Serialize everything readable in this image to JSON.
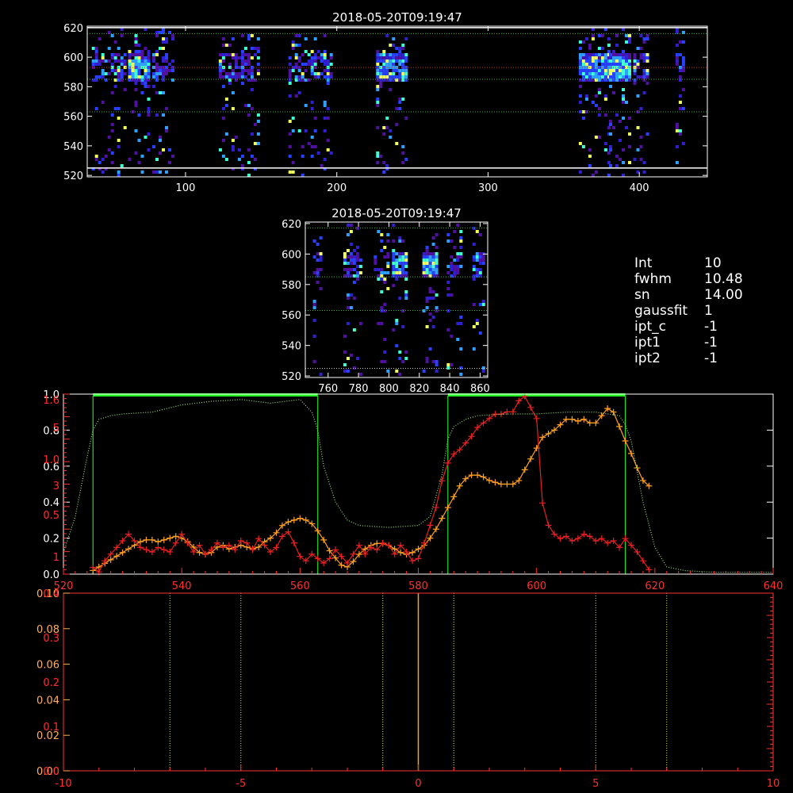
{
  "colors": {
    "background": "#000000",
    "axis_white": "#ffffff",
    "axis_red": "#ff3030",
    "orange": "#ffa020",
    "red": "#e82020",
    "green": "#22dd22",
    "dotted_green": "#9be07a",
    "yellow_dotted": "#e8e870"
  },
  "info": [
    {
      "key": "Int",
      "value": "10"
    },
    {
      "key": "fwhm",
      "value": "10.48"
    },
    {
      "key": "sn",
      "value": "14.00"
    },
    {
      "key": "gaussfit",
      "value": "1"
    },
    {
      "key": "ipt_c",
      "value": "-1"
    },
    {
      "key": "ipt1",
      "value": "-1"
    },
    {
      "key": "ipt2",
      "value": "-1"
    }
  ],
  "chart_data": [
    {
      "id": "top_image",
      "type": "heatmap",
      "title": "2018-05-20T09:19:47",
      "xlim": [
        35,
        445
      ],
      "ylim": [
        519,
        621
      ],
      "xticks": [
        100,
        200,
        300,
        400
      ],
      "yticks": [
        520,
        540,
        560,
        580,
        600,
        620
      ],
      "hlines": [
        {
          "y": 525,
          "style": "solid",
          "color": "#ffffff"
        },
        {
          "y": 563,
          "style": "dotted",
          "color": "#33bb33"
        },
        {
          "y": 585,
          "style": "dotted",
          "color": "#33bb33"
        },
        {
          "y": 593,
          "style": "dotted",
          "color": "#cc3322"
        },
        {
          "y": 616,
          "style": "dotted",
          "color": "#33bb33"
        },
        {
          "y": 620,
          "style": "solid",
          "color": "#ffffff"
        }
      ],
      "emission_bands": [
        [
          38,
          60
        ],
        [
          62,
          76
        ],
        [
          78,
          92
        ],
        [
          122,
          148
        ],
        [
          168,
          196
        ],
        [
          226,
          246
        ],
        [
          360,
          380
        ],
        [
          380,
          394
        ],
        [
          396,
          406
        ],
        [
          424,
          430
        ]
      ],
      "bright_bands": [
        [
          62,
          72
        ],
        [
          228,
          244
        ],
        [
          362,
          376
        ],
        [
          378,
          390
        ]
      ]
    },
    {
      "id": "mid_image",
      "type": "heatmap",
      "title": "2018-05-20T09:19:47",
      "xlim": [
        745,
        865
      ],
      "ylim": [
        519,
        621
      ],
      "xticks": [
        760,
        780,
        800,
        820,
        840,
        860
      ],
      "yticks": [
        520,
        540,
        560,
        580,
        600,
        620
      ],
      "hlines": [
        {
          "y": 525,
          "style": "dotted",
          "color": "#cccccc"
        },
        {
          "y": 563,
          "style": "dotted",
          "color": "#33bb33"
        },
        {
          "y": 585,
          "style": "dotted",
          "color": "#33bb33"
        },
        {
          "y": 617,
          "style": "dotted",
          "color": "#33bb33"
        }
      ],
      "emission_bands": [
        [
          750,
          756
        ],
        [
          770,
          782
        ],
        [
          790,
          800
        ],
        [
          802,
          812
        ],
        [
          822,
          832
        ],
        [
          838,
          848
        ],
        [
          855,
          862
        ]
      ],
      "bright_bands": [
        [
          804,
          810
        ],
        [
          824,
          830
        ]
      ]
    },
    {
      "id": "profile",
      "type": "line",
      "xlim": [
        520,
        640
      ],
      "xticks": [
        520,
        540,
        560,
        580,
        600,
        620,
        640
      ],
      "ylim_left_white": [
        0,
        1.0
      ],
      "yticks_left_white": [
        "0.0",
        "0.2",
        "0.4",
        "0.6",
        "0.8",
        "1.0"
      ],
      "ylim_left_red": [
        0,
        1.6
      ],
      "yticks_left_red": [
        "1",
        "1.0",
        "0.5",
        "3",
        "5",
        "1.6"
      ],
      "green_boxes": [
        [
          525,
          563
        ],
        [
          585,
          615
        ]
      ],
      "series": [
        {
          "color": "#ffa020",
          "marker": "+",
          "x": [
            525,
            526,
            527,
            528,
            529,
            530,
            531,
            532,
            533,
            534,
            535,
            536,
            537,
            538,
            539,
            540,
            541,
            542,
            543,
            544,
            545,
            546,
            547,
            548,
            549,
            550,
            551,
            552,
            553,
            554,
            555,
            556,
            557,
            558,
            559,
            560,
            561,
            562,
            563,
            564,
            565,
            566,
            567,
            568,
            569,
            570,
            571,
            572,
            573,
            574,
            575,
            576,
            577,
            578,
            579,
            580,
            581,
            582,
            583,
            584,
            585,
            586,
            587,
            588,
            589,
            590,
            591,
            592,
            593,
            594,
            595,
            596,
            597,
            598,
            599,
            600,
            601,
            602,
            603,
            604,
            605,
            606,
            607,
            608,
            609,
            610,
            611,
            612,
            613,
            614,
            615,
            616,
            617,
            618,
            619
          ],
          "y": [
            0.02,
            0.04,
            0.06,
            0.08,
            0.1,
            0.12,
            0.14,
            0.16,
            0.18,
            0.19,
            0.19,
            0.18,
            0.19,
            0.2,
            0.21,
            0.2,
            0.18,
            0.15,
            0.12,
            0.11,
            0.12,
            0.15,
            0.16,
            0.14,
            0.15,
            0.16,
            0.15,
            0.14,
            0.15,
            0.18,
            0.2,
            0.23,
            0.27,
            0.29,
            0.3,
            0.31,
            0.3,
            0.28,
            0.24,
            0.19,
            0.13,
            0.09,
            0.05,
            0.04,
            0.07,
            0.11,
            0.14,
            0.16,
            0.17,
            0.17,
            0.16,
            0.14,
            0.12,
            0.11,
            0.12,
            0.14,
            0.16,
            0.2,
            0.25,
            0.31,
            0.37,
            0.43,
            0.49,
            0.53,
            0.55,
            0.55,
            0.54,
            0.52,
            0.51,
            0.5,
            0.5,
            0.5,
            0.52,
            0.58,
            0.64,
            0.7,
            0.76,
            0.78,
            0.8,
            0.83,
            0.86,
            0.86,
            0.85,
            0.86,
            0.84,
            0.84,
            0.88,
            0.92,
            0.9,
            0.82,
            0.74,
            0.67,
            0.59,
            0.52,
            0.49
          ]
        },
        {
          "color": "#e82020",
          "marker": "+",
          "x": [
            525,
            526,
            527,
            528,
            529,
            530,
            531,
            532,
            533,
            534,
            535,
            536,
            537,
            538,
            539,
            540,
            541,
            542,
            543,
            544,
            545,
            546,
            547,
            548,
            549,
            550,
            551,
            552,
            553,
            554,
            555,
            556,
            557,
            558,
            559,
            560,
            561,
            562,
            563,
            564,
            565,
            566,
            567,
            568,
            569,
            570,
            571,
            572,
            573,
            574,
            575,
            576,
            577,
            578,
            579,
            580,
            581,
            582,
            583,
            584,
            585,
            586,
            587,
            588,
            589,
            590,
            591,
            592,
            593,
            594,
            595,
            596,
            597,
            598,
            599,
            600,
            601,
            602,
            603,
            604,
            605,
            606,
            607,
            608,
            609,
            610,
            611,
            612,
            613,
            614,
            615,
            616,
            617,
            618,
            619
          ],
          "y": [
            0.3,
            0.1,
            0.6,
            0.9,
            1.2,
            1.5,
            1.8,
            1.5,
            1.2,
            1.1,
            1.0,
            1.2,
            1.1,
            1.0,
            1.4,
            1.8,
            1.4,
            1.0,
            1.3,
            0.9,
            1.1,
            1.4,
            1.2,
            1.3,
            1.1,
            1.5,
            1.4,
            1.1,
            1.6,
            1.3,
            1.0,
            1.2,
            1.7,
            1.9,
            1.4,
            0.8,
            0.6,
            0.9,
            0.7,
            0.5,
            0.7,
            1.1,
            0.8,
            0.5,
            0.9,
            1.3,
            0.9,
            1.2,
            1.1,
            1.4,
            1.3,
            0.9,
            1.3,
            1.0,
            0.6,
            0.7,
            1.4,
            2.2,
            3.0,
            4.2,
            5.0,
            5.4,
            5.6,
            5.9,
            6.2,
            6.6,
            6.8,
            7.0,
            7.2,
            7.2,
            7.3,
            7.3,
            7.8,
            8.0,
            7.5,
            7.0,
            3.2,
            2.2,
            1.8,
            1.6,
            1.7,
            1.5,
            1.6,
            1.8,
            1.7,
            1.5,
            1.6,
            1.4,
            1.5,
            1.2,
            1.6,
            1.3,
            1.0,
            0.6,
            0.2
          ],
          "y_scale": "red",
          "note_y_scale": "red axis: 0 at bottom, 8 near top"
        },
        {
          "color": "#9be07a",
          "style": "dotted",
          "x": [
            520,
            522,
            524,
            525,
            526,
            528,
            530,
            535,
            540,
            545,
            550,
            555,
            560,
            562,
            563,
            564,
            566,
            568,
            570,
            575,
            580,
            582,
            584,
            585,
            586,
            588,
            590,
            595,
            600,
            605,
            610,
            614,
            615,
            616,
            618,
            620,
            622,
            625,
            630,
            635,
            640
          ],
          "y": [
            0.12,
            0.32,
            0.65,
            0.8,
            0.86,
            0.88,
            0.89,
            0.9,
            0.94,
            0.96,
            0.97,
            0.95,
            0.97,
            0.9,
            0.8,
            0.6,
            0.4,
            0.3,
            0.27,
            0.26,
            0.27,
            0.32,
            0.55,
            0.75,
            0.82,
            0.86,
            0.88,
            0.89,
            0.89,
            0.9,
            0.9,
            0.88,
            0.83,
            0.74,
            0.4,
            0.15,
            0.04,
            0.02,
            0.01,
            0.01,
            0.01
          ]
        }
      ]
    },
    {
      "id": "bottom",
      "type": "line",
      "xlim": [
        -10,
        10
      ],
      "xticks": [
        "-10",
        "-5",
        "0",
        "5",
        "10"
      ],
      "ylim_left_white": [
        0,
        0.1
      ],
      "yticks_left_white": [
        "0.00",
        "0.02",
        "0.04",
        "0.06",
        "0.08",
        "0.10"
      ],
      "ylim_left_red": [
        0,
        0.4
      ],
      "yticks_left_red": [
        "0.0",
        "0.1",
        "0.2",
        "0.3",
        "0.4"
      ],
      "vlines_dotted": [
        -7,
        -5,
        -1,
        1,
        5,
        7
      ],
      "vline_solid": 0
    }
  ]
}
